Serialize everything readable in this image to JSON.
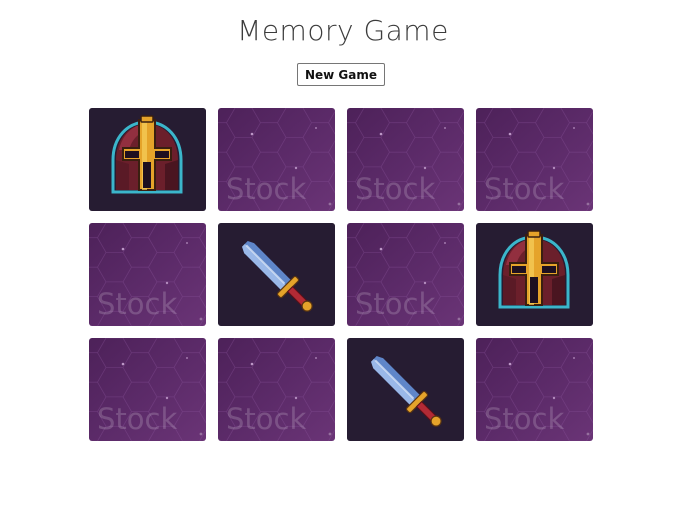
{
  "title": "Memory Game",
  "new_game_label": "New Game",
  "watermark_text": "Stock",
  "board": {
    "columns": 4,
    "rows": 3,
    "cards": [
      {
        "state": "face-up",
        "face": "helmet-icon"
      },
      {
        "state": "face-down",
        "face": null
      },
      {
        "state": "face-down",
        "face": null
      },
      {
        "state": "face-down",
        "face": null
      },
      {
        "state": "face-down",
        "face": null
      },
      {
        "state": "face-up",
        "face": "sword-icon"
      },
      {
        "state": "face-down",
        "face": null
      },
      {
        "state": "face-up",
        "face": "helmet-icon"
      },
      {
        "state": "face-down",
        "face": null
      },
      {
        "state": "face-down",
        "face": null
      },
      {
        "state": "face-up",
        "face": "sword-icon"
      },
      {
        "state": "face-down",
        "face": null
      }
    ]
  },
  "colors": {
    "card_back": "#5b2a68",
    "card_front": "#231a30",
    "title": "#3c3c3c"
  }
}
